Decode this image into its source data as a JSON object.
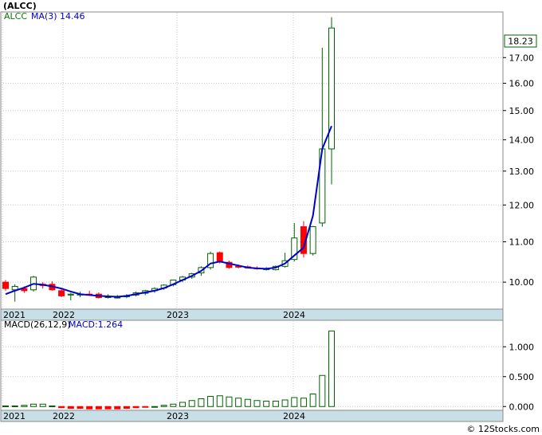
{
  "header": {
    "symbol": "(ALCC)",
    "copyright": "© 12Stocks.com"
  },
  "price_panel": {
    "legend_symbol": "ALCC",
    "legend_ma": "MA(3)",
    "legend_ma_value": "14.46",
    "last_price": "18.23",
    "yticks": [
      "10.00",
      "11.00",
      "12.00",
      "13.00",
      "14.00",
      "15.00",
      "16.00",
      "17.00"
    ]
  },
  "macd_panel": {
    "legend_label": "MACD(26,12,9)",
    "legend_value": "MACD:1.264",
    "yticks": [
      "0.000",
      "0.500",
      "1.000"
    ]
  },
  "x_axis": {
    "labels": [
      "2021",
      "2022",
      "2023",
      "2024"
    ]
  },
  "colors": {
    "up": "#006400",
    "down": "#ff0000",
    "ma": "#0000cc",
    "axis_band": "#c9dfe7",
    "grid": "#c8c8c8"
  },
  "chart_data": [
    {
      "type": "candlestick",
      "title": "(ALCC)",
      "scale": "log",
      "ylim": [
        9.4,
        18.9
      ],
      "series": [
        {
          "name": "ALCC",
          "columns": [
            "open",
            "high",
            "low",
            "close"
          ],
          "values": [
            [
              10.0,
              10.05,
              9.8,
              9.85
            ],
            [
              9.82,
              9.95,
              9.55,
              9.9
            ],
            [
              9.85,
              9.9,
              9.75,
              9.8
            ],
            [
              9.82,
              10.15,
              9.78,
              10.12
            ],
            [
              9.95,
              10.0,
              9.85,
              9.92
            ],
            [
              9.95,
              10.02,
              9.8,
              9.82
            ],
            [
              9.8,
              9.85,
              9.65,
              9.68
            ],
            [
              9.7,
              9.75,
              9.58,
              9.72
            ],
            [
              9.7,
              9.78,
              9.65,
              9.72
            ],
            [
              9.72,
              9.8,
              9.68,
              9.7
            ],
            [
              9.72,
              9.76,
              9.62,
              9.64
            ],
            [
              9.65,
              9.72,
              9.62,
              9.66
            ],
            [
              9.64,
              9.7,
              9.62,
              9.65
            ],
            [
              9.66,
              9.72,
              9.63,
              9.68
            ],
            [
              9.7,
              9.78,
              9.67,
              9.75
            ],
            [
              9.74,
              9.82,
              9.7,
              9.8
            ],
            [
              9.8,
              9.88,
              9.75,
              9.85
            ],
            [
              9.86,
              9.95,
              9.82,
              9.93
            ],
            [
              9.94,
              10.06,
              9.9,
              10.05
            ],
            [
              10.05,
              10.15,
              10.0,
              10.12
            ],
            [
              10.12,
              10.22,
              10.08,
              10.2
            ],
            [
              10.22,
              10.38,
              10.15,
              10.35
            ],
            [
              10.35,
              10.75,
              10.3,
              10.7
            ],
            [
              10.72,
              10.75,
              10.45,
              10.5
            ],
            [
              10.48,
              10.52,
              10.32,
              10.35
            ],
            [
              10.38,
              10.42,
              10.33,
              10.36
            ],
            [
              10.37,
              10.4,
              10.33,
              10.34
            ],
            [
              10.34,
              10.38,
              10.3,
              10.32
            ],
            [
              10.3,
              10.36,
              10.28,
              10.32
            ],
            [
              10.3,
              10.4,
              10.28,
              10.38
            ],
            [
              10.38,
              10.72,
              10.35,
              10.52
            ],
            [
              10.55,
              11.5,
              10.5,
              11.1
            ],
            [
              11.4,
              11.55,
              10.6,
              10.7
            ],
            [
              10.7,
              11.42,
              10.65,
              11.4
            ],
            [
              11.5,
              17.4,
              11.4,
              13.7
            ],
            [
              13.7,
              18.7,
              12.6,
              18.23
            ]
          ]
        },
        {
          "name": "MA(3)",
          "values": [
            9.72,
            9.8,
            9.87,
            9.96,
            9.94,
            9.9,
            9.85,
            9.78,
            9.72,
            9.7,
            9.68,
            9.67,
            9.66,
            9.68,
            9.72,
            9.76,
            9.8,
            9.86,
            9.95,
            10.05,
            10.15,
            10.27,
            10.45,
            10.5,
            10.45,
            10.4,
            10.35,
            10.33,
            10.32,
            10.35,
            10.45,
            10.65,
            10.85,
            11.7,
            13.7,
            14.46
          ]
        }
      ]
    },
    {
      "type": "bar",
      "title": "MACD(26,12,9)",
      "ylim": [
        -0.05,
        1.43
      ],
      "series": [
        {
          "name": "MACD",
          "values": [
            0.01,
            0.01,
            0.02,
            0.04,
            0.04,
            0.01,
            -0.02,
            -0.03,
            -0.03,
            -0.04,
            -0.04,
            -0.04,
            -0.04,
            -0.03,
            -0.02,
            -0.01,
            0.0,
            0.02,
            0.04,
            0.07,
            0.1,
            0.13,
            0.17,
            0.18,
            0.16,
            0.14,
            0.12,
            0.1,
            0.09,
            0.09,
            0.11,
            0.15,
            0.14,
            0.21,
            0.52,
            1.264
          ]
        }
      ]
    }
  ]
}
